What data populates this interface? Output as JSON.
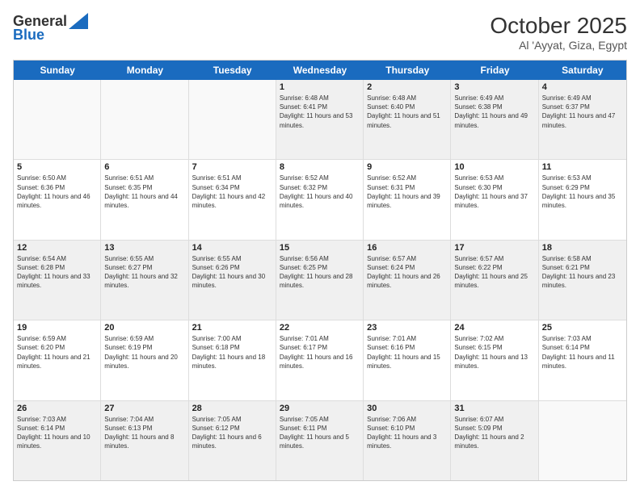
{
  "header": {
    "logo_general": "General",
    "logo_blue": "Blue",
    "month": "October 2025",
    "location": "Al 'Ayyat, Giza, Egypt"
  },
  "days_of_week": [
    "Sunday",
    "Monday",
    "Tuesday",
    "Wednesday",
    "Thursday",
    "Friday",
    "Saturday"
  ],
  "weeks": [
    [
      {
        "day": "",
        "empty": true
      },
      {
        "day": "",
        "empty": true
      },
      {
        "day": "",
        "empty": true
      },
      {
        "day": "1",
        "sunrise": "6:48 AM",
        "sunset": "6:41 PM",
        "daylight": "11 hours and 53 minutes."
      },
      {
        "day": "2",
        "sunrise": "6:48 AM",
        "sunset": "6:40 PM",
        "daylight": "11 hours and 51 minutes."
      },
      {
        "day": "3",
        "sunrise": "6:49 AM",
        "sunset": "6:38 PM",
        "daylight": "11 hours and 49 minutes."
      },
      {
        "day": "4",
        "sunrise": "6:49 AM",
        "sunset": "6:37 PM",
        "daylight": "11 hours and 47 minutes."
      }
    ],
    [
      {
        "day": "5",
        "sunrise": "6:50 AM",
        "sunset": "6:36 PM",
        "daylight": "11 hours and 46 minutes."
      },
      {
        "day": "6",
        "sunrise": "6:51 AM",
        "sunset": "6:35 PM",
        "daylight": "11 hours and 44 minutes."
      },
      {
        "day": "7",
        "sunrise": "6:51 AM",
        "sunset": "6:34 PM",
        "daylight": "11 hours and 42 minutes."
      },
      {
        "day": "8",
        "sunrise": "6:52 AM",
        "sunset": "6:32 PM",
        "daylight": "11 hours and 40 minutes."
      },
      {
        "day": "9",
        "sunrise": "6:52 AM",
        "sunset": "6:31 PM",
        "daylight": "11 hours and 39 minutes."
      },
      {
        "day": "10",
        "sunrise": "6:53 AM",
        "sunset": "6:30 PM",
        "daylight": "11 hours and 37 minutes."
      },
      {
        "day": "11",
        "sunrise": "6:53 AM",
        "sunset": "6:29 PM",
        "daylight": "11 hours and 35 minutes."
      }
    ],
    [
      {
        "day": "12",
        "sunrise": "6:54 AM",
        "sunset": "6:28 PM",
        "daylight": "11 hours and 33 minutes."
      },
      {
        "day": "13",
        "sunrise": "6:55 AM",
        "sunset": "6:27 PM",
        "daylight": "11 hours and 32 minutes."
      },
      {
        "day": "14",
        "sunrise": "6:55 AM",
        "sunset": "6:26 PM",
        "daylight": "11 hours and 30 minutes."
      },
      {
        "day": "15",
        "sunrise": "6:56 AM",
        "sunset": "6:25 PM",
        "daylight": "11 hours and 28 minutes."
      },
      {
        "day": "16",
        "sunrise": "6:57 AM",
        "sunset": "6:24 PM",
        "daylight": "11 hours and 26 minutes."
      },
      {
        "day": "17",
        "sunrise": "6:57 AM",
        "sunset": "6:22 PM",
        "daylight": "11 hours and 25 minutes."
      },
      {
        "day": "18",
        "sunrise": "6:58 AM",
        "sunset": "6:21 PM",
        "daylight": "11 hours and 23 minutes."
      }
    ],
    [
      {
        "day": "19",
        "sunrise": "6:59 AM",
        "sunset": "6:20 PM",
        "daylight": "11 hours and 21 minutes."
      },
      {
        "day": "20",
        "sunrise": "6:59 AM",
        "sunset": "6:19 PM",
        "daylight": "11 hours and 20 minutes."
      },
      {
        "day": "21",
        "sunrise": "7:00 AM",
        "sunset": "6:18 PM",
        "daylight": "11 hours and 18 minutes."
      },
      {
        "day": "22",
        "sunrise": "7:01 AM",
        "sunset": "6:17 PM",
        "daylight": "11 hours and 16 minutes."
      },
      {
        "day": "23",
        "sunrise": "7:01 AM",
        "sunset": "6:16 PM",
        "daylight": "11 hours and 15 minutes."
      },
      {
        "day": "24",
        "sunrise": "7:02 AM",
        "sunset": "6:15 PM",
        "daylight": "11 hours and 13 minutes."
      },
      {
        "day": "25",
        "sunrise": "7:03 AM",
        "sunset": "6:14 PM",
        "daylight": "11 hours and 11 minutes."
      }
    ],
    [
      {
        "day": "26",
        "sunrise": "7:03 AM",
        "sunset": "6:14 PM",
        "daylight": "11 hours and 10 minutes."
      },
      {
        "day": "27",
        "sunrise": "7:04 AM",
        "sunset": "6:13 PM",
        "daylight": "11 hours and 8 minutes."
      },
      {
        "day": "28",
        "sunrise": "7:05 AM",
        "sunset": "6:12 PM",
        "daylight": "11 hours and 6 minutes."
      },
      {
        "day": "29",
        "sunrise": "7:05 AM",
        "sunset": "6:11 PM",
        "daylight": "11 hours and 5 minutes."
      },
      {
        "day": "30",
        "sunrise": "7:06 AM",
        "sunset": "6:10 PM",
        "daylight": "11 hours and 3 minutes."
      },
      {
        "day": "31",
        "sunrise": "6:07 AM",
        "sunset": "5:09 PM",
        "daylight": "11 hours and 2 minutes."
      },
      {
        "day": "",
        "empty": true
      }
    ]
  ]
}
